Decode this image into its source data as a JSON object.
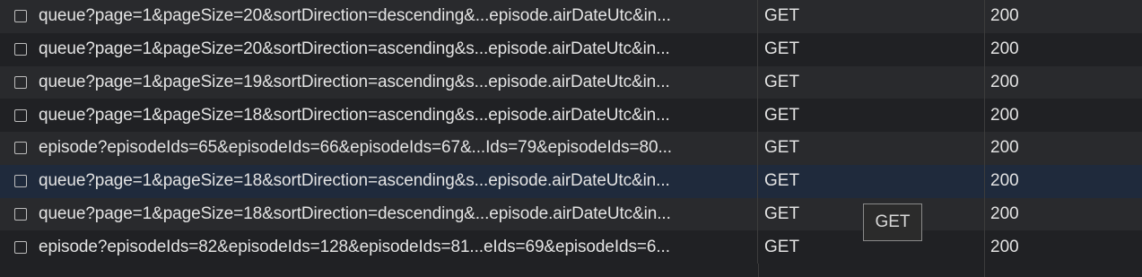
{
  "requests": [
    {
      "name": "queue?page=1&pageSize=20&sortDirection=descending&...episode.airDateUtc&in...",
      "method": "GET",
      "status": "200"
    },
    {
      "name": "queue?page=1&pageSize=20&sortDirection=ascending&s...episode.airDateUtc&in...",
      "method": "GET",
      "status": "200"
    },
    {
      "name": "queue?page=1&pageSize=19&sortDirection=ascending&s...episode.airDateUtc&in...",
      "method": "GET",
      "status": "200"
    },
    {
      "name": "queue?page=1&pageSize=18&sortDirection=ascending&s...episode.airDateUtc&in...",
      "method": "GET",
      "status": "200"
    },
    {
      "name": "episode?episodeIds=65&episodeIds=66&episodeIds=67&...Ids=79&episodeIds=80...",
      "method": "GET",
      "status": "200"
    },
    {
      "name": "queue?page=1&pageSize=18&sortDirection=ascending&s...episode.airDateUtc&in...",
      "method": "GET",
      "status": "200"
    },
    {
      "name": "queue?page=1&pageSize=18&sortDirection=descending&...episode.airDateUtc&in...",
      "method": "GET",
      "status": "200"
    },
    {
      "name": "episode?episodeIds=82&episodeIds=128&episodeIds=81...eIds=69&episodeIds=6...",
      "method": "GET",
      "status": "200"
    }
  ],
  "selected_index": 5,
  "tooltip": {
    "text": "GET"
  },
  "colors": {
    "background": "#202124",
    "row_alt": "#292a2d",
    "row_selected": "#1f2a3c",
    "text": "#e3e3e3"
  }
}
